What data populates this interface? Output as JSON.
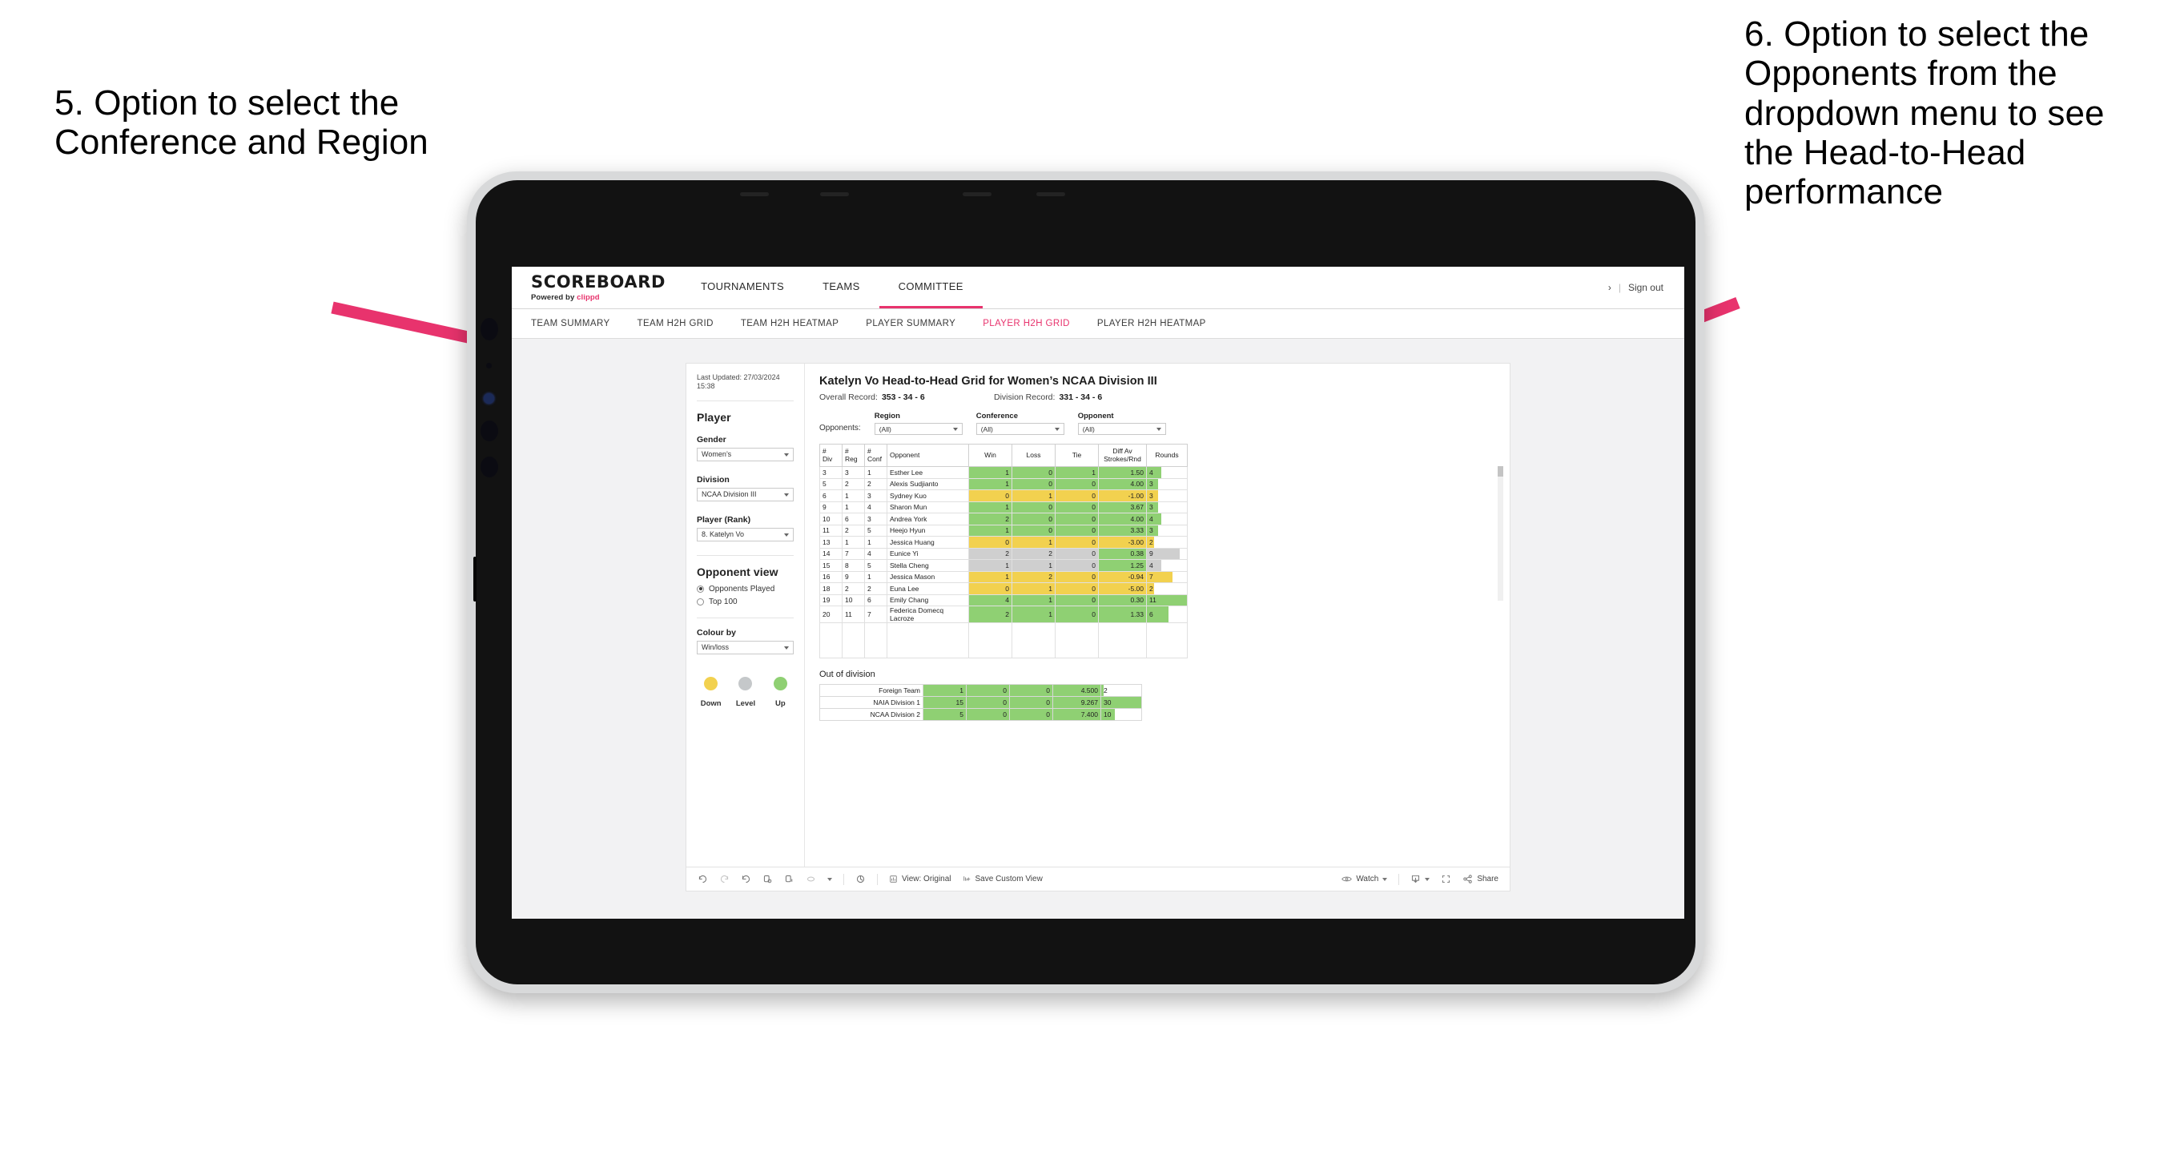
{
  "annotations": {
    "left": "5. Option to select the Conference and Region",
    "right": "6. Option to select the Opponents from the dropdown menu to see the Head-to-Head performance",
    "arrow_color": "#e8336d"
  },
  "header": {
    "brand_title": "SCOREBOARD",
    "brand_powered": "Powered by",
    "brand_name": "clippd",
    "nav": [
      {
        "label": "TOURNAMENTS",
        "active": false
      },
      {
        "label": "TEAMS",
        "active": false
      },
      {
        "label": "COMMITTEE",
        "active": true
      }
    ],
    "user_chevron": "›",
    "separator": "|",
    "sign_out": "Sign out"
  },
  "subnav": [
    {
      "label": "TEAM SUMMARY",
      "active": false
    },
    {
      "label": "TEAM H2H GRID",
      "active": false
    },
    {
      "label": "TEAM H2H HEATMAP",
      "active": false
    },
    {
      "label": "PLAYER SUMMARY",
      "active": false
    },
    {
      "label": "PLAYER H2H GRID",
      "active": true
    },
    {
      "label": "PLAYER H2H HEATMAP",
      "active": false
    }
  ],
  "sidebar": {
    "last_updated": "Last Updated: 27/03/2024 15:38",
    "player_heading": "Player",
    "gender": {
      "label": "Gender",
      "value": "Women’s"
    },
    "division": {
      "label": "Division",
      "value": "NCAA Division III"
    },
    "player_rank": {
      "label": "Player (Rank)",
      "value": "8. Katelyn Vo"
    },
    "opponent_view": {
      "heading": "Opponent view",
      "options": [
        {
          "label": "Opponents Played",
          "selected": true
        },
        {
          "label": "Top 100",
          "selected": false
        }
      ]
    },
    "colour_by": {
      "label": "Colour by",
      "value": "Win/loss"
    },
    "legend": [
      {
        "caption": "Down",
        "color": "#f2d14f"
      },
      {
        "caption": "Level",
        "color": "#c5c8ca"
      },
      {
        "caption": "Up",
        "color": "#8fd073"
      }
    ]
  },
  "viz": {
    "title": "Katelyn Vo Head-to-Head Grid for Women’s NCAA Division III",
    "overall_record": {
      "label": "Overall Record:",
      "value": "353 - 34 - 6"
    },
    "division_record": {
      "label": "Division Record:",
      "value": "331 - 34 - 6"
    },
    "opponents_label": "Opponents:",
    "filters": [
      {
        "label": "Region",
        "value": "(All)"
      },
      {
        "label": "Conference",
        "value": "(All)"
      },
      {
        "label": "Opponent",
        "value": "(All)"
      }
    ],
    "out_of_division_title": "Out of division"
  },
  "chart_data": {
    "type": "table",
    "title": "Katelyn Vo Head-to-Head Grid for Women’s NCAA Division III",
    "columns": [
      "# Div",
      "# Reg",
      "# Conf",
      "Opponent",
      "Win",
      "Loss",
      "Tie",
      "Diff Av Strokes/Rnd",
      "Rounds"
    ],
    "header_lines": [
      [
        "#",
        "Div"
      ],
      [
        "#",
        "Reg"
      ],
      [
        "#",
        "Conf"
      ],
      [
        "Opponent"
      ],
      [
        "Win"
      ],
      [
        "Loss"
      ],
      [
        "Tie"
      ],
      [
        "Diff Av",
        "Strokes/Rnd"
      ],
      [
        "Rounds"
      ]
    ],
    "rounds_max": 11,
    "rows": [
      {
        "div": "3",
        "reg": "3",
        "conf": "1",
        "opponent": "Esther Lee",
        "win": "1",
        "loss": "0",
        "tie": "1",
        "diff": "1.50",
        "rounds": "4",
        "state": "up"
      },
      {
        "div": "5",
        "reg": "2",
        "conf": "2",
        "opponent": "Alexis Sudjianto",
        "win": "1",
        "loss": "0",
        "tie": "0",
        "diff": "4.00",
        "rounds": "3",
        "state": "up"
      },
      {
        "div": "6",
        "reg": "1",
        "conf": "3",
        "opponent": "Sydney Kuo",
        "win": "0",
        "loss": "1",
        "tie": "0",
        "diff": "-1.00",
        "rounds": "3",
        "state": "down"
      },
      {
        "div": "9",
        "reg": "1",
        "conf": "4",
        "opponent": "Sharon Mun",
        "win": "1",
        "loss": "0",
        "tie": "0",
        "diff": "3.67",
        "rounds": "3",
        "state": "up"
      },
      {
        "div": "10",
        "reg": "6",
        "conf": "3",
        "opponent": "Andrea York",
        "win": "2",
        "loss": "0",
        "tie": "0",
        "diff": "4.00",
        "rounds": "4",
        "state": "up"
      },
      {
        "div": "11",
        "reg": "2",
        "conf": "5",
        "opponent": "Heejo Hyun",
        "win": "1",
        "loss": "0",
        "tie": "0",
        "diff": "3.33",
        "rounds": "3",
        "state": "up"
      },
      {
        "div": "13",
        "reg": "1",
        "conf": "1",
        "opponent": "Jessica Huang",
        "win": "0",
        "loss": "1",
        "tie": "0",
        "diff": "-3.00",
        "rounds": "2",
        "state": "down"
      },
      {
        "div": "14",
        "reg": "7",
        "conf": "4",
        "opponent": "Eunice Yi",
        "win": "2",
        "loss": "2",
        "tie": "0",
        "diff": "0.38",
        "rounds": "9",
        "state": "level"
      },
      {
        "div": "15",
        "reg": "8",
        "conf": "5",
        "opponent": "Stella Cheng",
        "win": "1",
        "loss": "1",
        "tie": "0",
        "diff": "1.25",
        "rounds": "4",
        "state": "level"
      },
      {
        "div": "16",
        "reg": "9",
        "conf": "1",
        "opponent": "Jessica Mason",
        "win": "1",
        "loss": "2",
        "tie": "0",
        "diff": "-0.94",
        "rounds": "7",
        "state": "down"
      },
      {
        "div": "18",
        "reg": "2",
        "conf": "2",
        "opponent": "Euna Lee",
        "win": "0",
        "loss": "1",
        "tie": "0",
        "diff": "-5.00",
        "rounds": "2",
        "state": "down"
      },
      {
        "div": "19",
        "reg": "10",
        "conf": "6",
        "opponent": "Emily Chang",
        "win": "4",
        "loss": "1",
        "tie": "0",
        "diff": "0.30",
        "rounds": "11",
        "state": "up"
      },
      {
        "div": "20",
        "reg": "11",
        "conf": "7",
        "opponent": "Federica Domecq Lacroze",
        "win": "2",
        "loss": "1",
        "tie": "0",
        "diff": "1.33",
        "rounds": "6",
        "state": "up"
      }
    ],
    "out_of_division": {
      "rounds_max": 30,
      "rows": [
        {
          "name": "Foreign Team",
          "win": "1",
          "loss": "0",
          "tie": "0",
          "diff": "4.500",
          "rounds": "2",
          "state": "up"
        },
        {
          "name": "NAIA Division 1",
          "win": "15",
          "loss": "0",
          "tie": "0",
          "diff": "9.267",
          "rounds": "30",
          "state": "up"
        },
        {
          "name": "NCAA Division 2",
          "win": "5",
          "loss": "0",
          "tie": "0",
          "diff": "7.400",
          "rounds": "10",
          "state": "up"
        }
      ]
    }
  },
  "toolbar": {
    "icons": [
      "undo-icon",
      "redo-icon",
      "revert-icon",
      "refresh-icon",
      "pause-icon",
      "ellipse-icon"
    ],
    "view_label": "View: Original",
    "save_label": "Save Custom View",
    "watch_label": "Watch",
    "share_label": "Share"
  },
  "colors": {
    "accent": "#e8336d",
    "up": "#8fd073",
    "down": "#f2d14f",
    "level": "#c5c8ca",
    "canvas": "#f2f2f3"
  }
}
